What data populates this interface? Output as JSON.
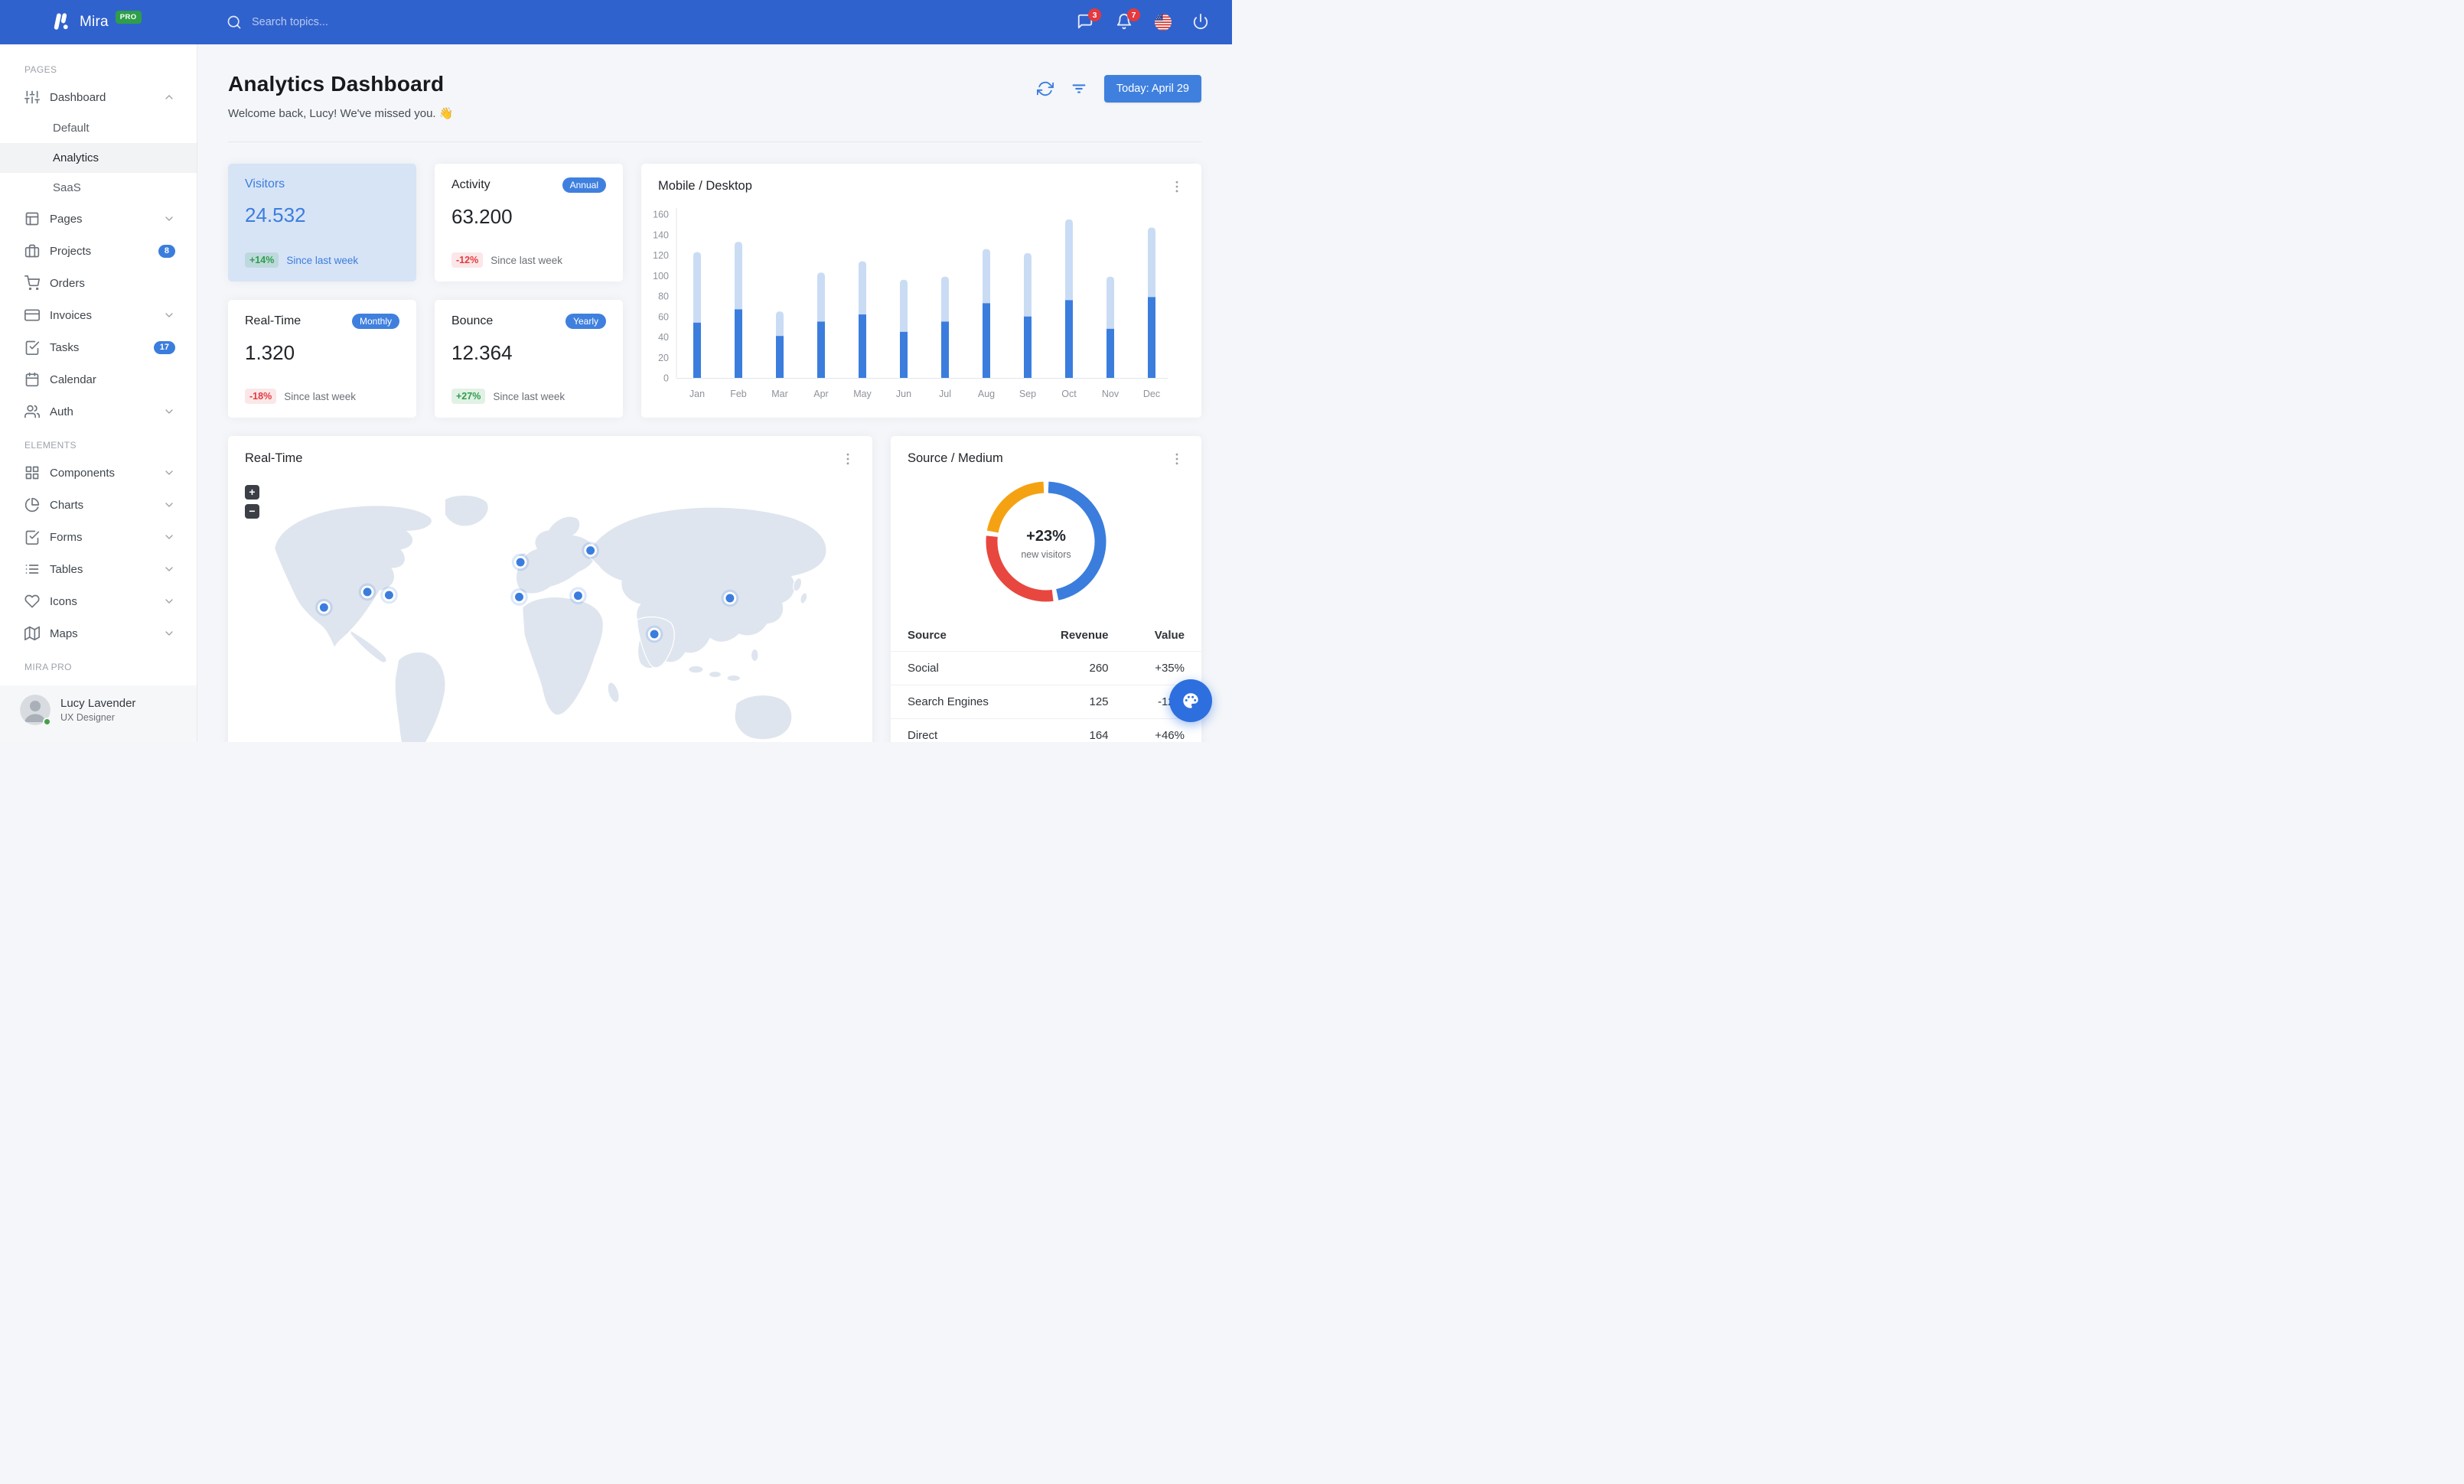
{
  "colors": {
    "navbar": "#3062CD",
    "primary": "#3B7DDD",
    "primary_button": "#3F80DF",
    "pro_badge_green": "#2E9E49",
    "success_text": "#2E9E49",
    "danger_text": "#E23B40",
    "notification_badge": "#E5393D",
    "bar_mobile": "#3B7DDD",
    "bar_desktop": "#CADCF4",
    "donut_blue": "#3B7DDD",
    "donut_red": "#E8473F",
    "donut_orange": "#F5A212",
    "map_land": "#DFE5EE",
    "map_marker": "#3B7DDD",
    "status_online": "#43A047"
  },
  "navbar": {
    "brand": "Mira",
    "brand_badge": "PRO",
    "search_placeholder": "Search topics...",
    "messages_badge": "3",
    "notifications_badge": "7"
  },
  "sidebar": {
    "sections": [
      {
        "label": "PAGES",
        "items": [
          {
            "icon": "sliders",
            "label": "Dashboard",
            "chevron": "up",
            "children": [
              {
                "label": "Default",
                "active": false
              },
              {
                "label": "Analytics",
                "active": true
              },
              {
                "label": "SaaS",
                "active": false
              }
            ]
          },
          {
            "icon": "layout",
            "label": "Pages",
            "chevron": "down"
          },
          {
            "icon": "briefcase",
            "label": "Projects",
            "badge": "8"
          },
          {
            "icon": "shopping-cart",
            "label": "Orders"
          },
          {
            "icon": "credit-card",
            "label": "Invoices",
            "chevron": "down"
          },
          {
            "icon": "check-square",
            "label": "Tasks",
            "badge": "17"
          },
          {
            "icon": "calendar",
            "label": "Calendar"
          },
          {
            "icon": "users",
            "label": "Auth",
            "chevron": "down"
          }
        ]
      },
      {
        "label": "ELEMENTS",
        "items": [
          {
            "icon": "grid",
            "label": "Components",
            "chevron": "down"
          },
          {
            "icon": "pie-chart",
            "label": "Charts",
            "chevron": "down"
          },
          {
            "icon": "check-square",
            "label": "Forms",
            "chevron": "down"
          },
          {
            "icon": "list",
            "label": "Tables",
            "chevron": "down"
          },
          {
            "icon": "heart",
            "label": "Icons",
            "chevron": "down"
          },
          {
            "icon": "map",
            "label": "Maps",
            "chevron": "down"
          }
        ]
      },
      {
        "label": "MIRA PRO",
        "items": []
      }
    ],
    "user": {
      "name": "Lucy Lavender",
      "role": "UX Designer",
      "status": "online"
    }
  },
  "header": {
    "title": "Analytics Dashboard",
    "welcome": "Welcome back, Lucy! We've missed you.",
    "welcome_emoji": "👋",
    "date_button": "Today: April 29"
  },
  "stats": [
    {
      "title": "Visitors",
      "badge": "",
      "value": "24.532",
      "delta": "+14%",
      "delta_type": "positive",
      "note": "Since last week",
      "variant": "primary"
    },
    {
      "title": "Activity",
      "badge": "Annual",
      "value": "63.200",
      "delta": "-12%",
      "delta_type": "negative",
      "note": "Since last week",
      "variant": "default"
    },
    {
      "title": "Real-Time",
      "badge": "Monthly",
      "value": "1.320",
      "delta": "-18%",
      "delta_type": "negative",
      "note": "Since last week",
      "variant": "default"
    },
    {
      "title": "Bounce",
      "badge": "Yearly",
      "value": "12.364",
      "delta": "+27%",
      "delta_type": "positive",
      "note": "Since last week",
      "variant": "default"
    }
  ],
  "chart_data": [
    {
      "id": "mobile_desktop",
      "type": "bar",
      "stacked": true,
      "title": "Mobile / Desktop",
      "categories": [
        "Jan",
        "Feb",
        "Mar",
        "Apr",
        "May",
        "Jun",
        "Jul",
        "Aug",
        "Sep",
        "Oct",
        "Nov",
        "Dec"
      ],
      "series": [
        {
          "name": "Mobile",
          "color": "#3B7DDD",
          "values": [
            54,
            67,
            41,
            55,
            62,
            45,
            55,
            73,
            60,
            76,
            48,
            79
          ]
        },
        {
          "name": "Desktop",
          "color": "#CADCF4",
          "values": [
            69,
            66,
            24,
            48,
            52,
            51,
            44,
            53,
            62,
            79,
            51,
            68
          ]
        }
      ],
      "ylim": [
        0,
        160
      ],
      "ytick_step": 20,
      "grid": false,
      "legend": "none"
    },
    {
      "id": "source_medium",
      "type": "pie",
      "donut": true,
      "title": "Source / Medium",
      "slices": [
        {
          "label": "Social",
          "value": 260,
          "color": "#3B7DDD"
        },
        {
          "label": "Direct",
          "value": 164,
          "color": "#E8473F"
        },
        {
          "label": "Search Engines",
          "value": 125,
          "color": "#F5A212"
        }
      ],
      "center_title": "+23%",
      "center_subtitle": "new visitors",
      "legend": "none"
    }
  ],
  "map": {
    "title": "Real-Time",
    "zoom_in_label": "+",
    "zoom_out_label": "−",
    "markers": [
      {
        "name": "us-west",
        "x": 135,
        "y": 215
      },
      {
        "name": "us-midwest",
        "x": 205,
        "y": 190
      },
      {
        "name": "us-east",
        "x": 240,
        "y": 195
      },
      {
        "name": "uk",
        "x": 452,
        "y": 142
      },
      {
        "name": "spain",
        "x": 450,
        "y": 198
      },
      {
        "name": "russia",
        "x": 565,
        "y": 123
      },
      {
        "name": "turkey",
        "x": 545,
        "y": 196
      },
      {
        "name": "india",
        "x": 668,
        "y": 258
      },
      {
        "name": "china",
        "x": 790,
        "y": 200
      }
    ]
  },
  "source_table": {
    "headers": [
      "Source",
      "Revenue",
      "Value"
    ],
    "rows": [
      {
        "source": "Social",
        "revenue": "260",
        "value": "+35%",
        "trend": "up"
      },
      {
        "source": "Search Engines",
        "revenue": "125",
        "value": "-12%",
        "trend": "down"
      },
      {
        "source": "Direct",
        "revenue": "164",
        "value": "+46%",
        "trend": "up"
      }
    ]
  }
}
